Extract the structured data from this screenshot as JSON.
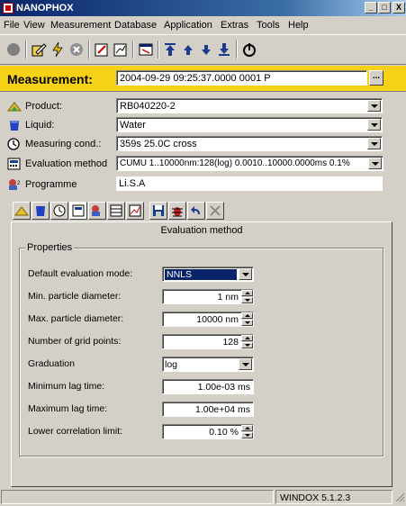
{
  "window": {
    "title": "NANOPHOX"
  },
  "menu": [
    "File",
    "View",
    "Measurement",
    "Database",
    "Application",
    "Extras",
    "Tools",
    "Help"
  ],
  "toolbar_icons": [
    "record-icon",
    "lightning-icon",
    "stop-icon",
    "edit-icon",
    "edit2-icon",
    "chart-icon",
    "move-top-icon",
    "up-arrow-icon",
    "down-arrow-icon",
    "move-bottom-icon",
    "power-icon"
  ],
  "measurement": {
    "label": "Measurement:",
    "value": "2004-09-29 09:25:37.0000 0001 P"
  },
  "rows": [
    {
      "label": "Product:",
      "value": "RB040220-2",
      "type": "combo",
      "icon": "product-icon"
    },
    {
      "label": "Liquid:",
      "value": "Water",
      "type": "combo",
      "icon": "liquid-icon"
    },
    {
      "label": "Measuring cond.:",
      "value": "359s 25.0C cross",
      "type": "combo",
      "icon": "clock-icon"
    },
    {
      "label": "Evaluation method",
      "value": "CUMU 1..10000nm:128(log) 0.0010..10000.0000ms 0.1%",
      "type": "combo",
      "icon": "calculator-icon"
    },
    {
      "label": "Programme",
      "value": "Li.S.A",
      "type": "text",
      "icon": "programme-icon"
    }
  ],
  "panel": {
    "header": "Evaluation method",
    "group_title": "Properties",
    "properties": [
      {
        "label": "Default evaluation mode:",
        "value": "NNLS",
        "unit": "",
        "control": "select"
      },
      {
        "label": "Min. particle diameter:",
        "value": "1",
        "unit": "nm",
        "control": "spin"
      },
      {
        "label": "Max. particle diameter:",
        "value": "10000",
        "unit": "nm",
        "control": "spin"
      },
      {
        "label": "Number of grid points:",
        "value": "128",
        "unit": "",
        "control": "spin"
      },
      {
        "label": "Graduation",
        "value": "log",
        "unit": "",
        "control": "select"
      },
      {
        "label": "Minimum lag time:",
        "value": "1.00e-03",
        "unit": "ms",
        "control": "text"
      },
      {
        "label": "Maximum lag time:",
        "value": "1.00e+04",
        "unit": "ms",
        "control": "text"
      },
      {
        "label": "Lower correlation limit:",
        "value": "0.10",
        "unit": "%",
        "control": "spin"
      }
    ]
  },
  "status": {
    "version": "WINDOX 5.1.2.3"
  },
  "colors": {
    "titlebar": "#0a246a",
    "measurement_bar": "#f7d117",
    "selection": "#0a246a",
    "face": "#d4d0c8"
  }
}
